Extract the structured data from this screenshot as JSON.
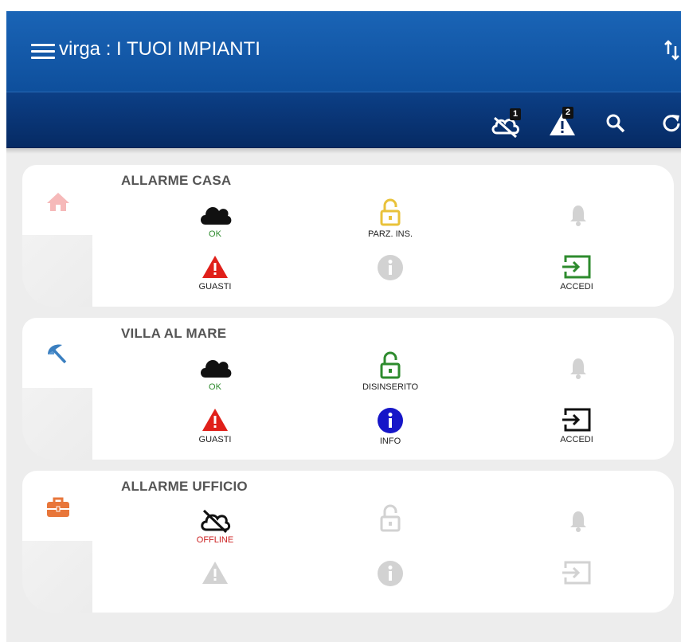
{
  "header": {
    "user": "virga",
    "separator": " : ",
    "section": "I TUOI IMPIANTI",
    "offline_count": "1",
    "fault_count": "2"
  },
  "colors": {
    "header_top": "#1a64b6",
    "header_bottom": "#062a63",
    "ok_green": "#2e8b2e",
    "warning_red": "#e0201a",
    "info_blue": "#1616c8",
    "partial_yellow": "#e9c23a",
    "disabled_gray": "#d2d2d2",
    "offline_red": "#cc2222"
  },
  "plants": [
    {
      "name": "ALLARME CASA",
      "icon": "home-icon",
      "connection_label": "OK",
      "lock_label": "PARZ. INS.",
      "fault_label": "GUASTI",
      "access_label": "ACCEDI"
    },
    {
      "name": "VILLA AL MARE",
      "icon": "beach-umbrella-icon",
      "connection_label": "OK",
      "lock_label": "DISINSERITO",
      "fault_label": "GUASTI",
      "info_label": "INFO",
      "access_label": "ACCEDI"
    },
    {
      "name": "ALLARME UFFICIO",
      "icon": "briefcase-icon",
      "connection_label": "OFFLINE"
    }
  ]
}
